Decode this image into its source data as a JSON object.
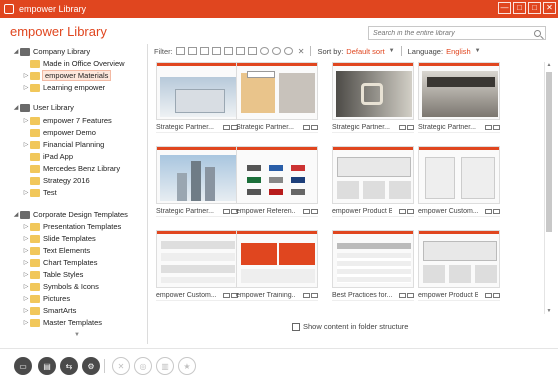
{
  "window": {
    "title": "empower Library",
    "controls": [
      "—",
      "□",
      "□",
      "✕"
    ]
  },
  "heading": "empower Library",
  "search": {
    "placeholder": "Search in the entire library"
  },
  "sidebar": {
    "company_library": {
      "label": "Company Library",
      "items": [
        "Made in Office Overview",
        "empower Materials",
        "Learning empower"
      ]
    },
    "user_library": {
      "label": "User Library",
      "items": [
        "empower 7 Features",
        "empower Demo",
        "Financial Planning",
        "iPad App",
        "Mercedes Benz Library",
        "Strategy 2016",
        "Test"
      ]
    },
    "cd_templates": {
      "label": "Corporate Design Templates",
      "items": [
        "Presentation Templates",
        "Slide Templates",
        "Text Elements",
        "Chart Templates",
        "Table Styles",
        "Symbols & Icons",
        "Pictures",
        "SmartArts",
        "Master Templates"
      ]
    }
  },
  "filter": {
    "label": "Filter:",
    "sort_label": "Sort by:",
    "sort_value": "Default sort",
    "language_label": "Language:",
    "language_value": "English"
  },
  "cards": [
    "Strategic Partner...",
    "Strategic Partner...",
    "Strategic Partner...",
    "Strategic Partner...",
    "Strategic Partner...",
    "empower Referen...",
    "empower Product Br...",
    "empower Custom...",
    "empower Custom...",
    "empower Training...",
    "Best Practices for...",
    "empower Product Br..."
  ],
  "folder_link": "Show content in folder structure",
  "colors": {
    "accent": "#e0461f"
  }
}
